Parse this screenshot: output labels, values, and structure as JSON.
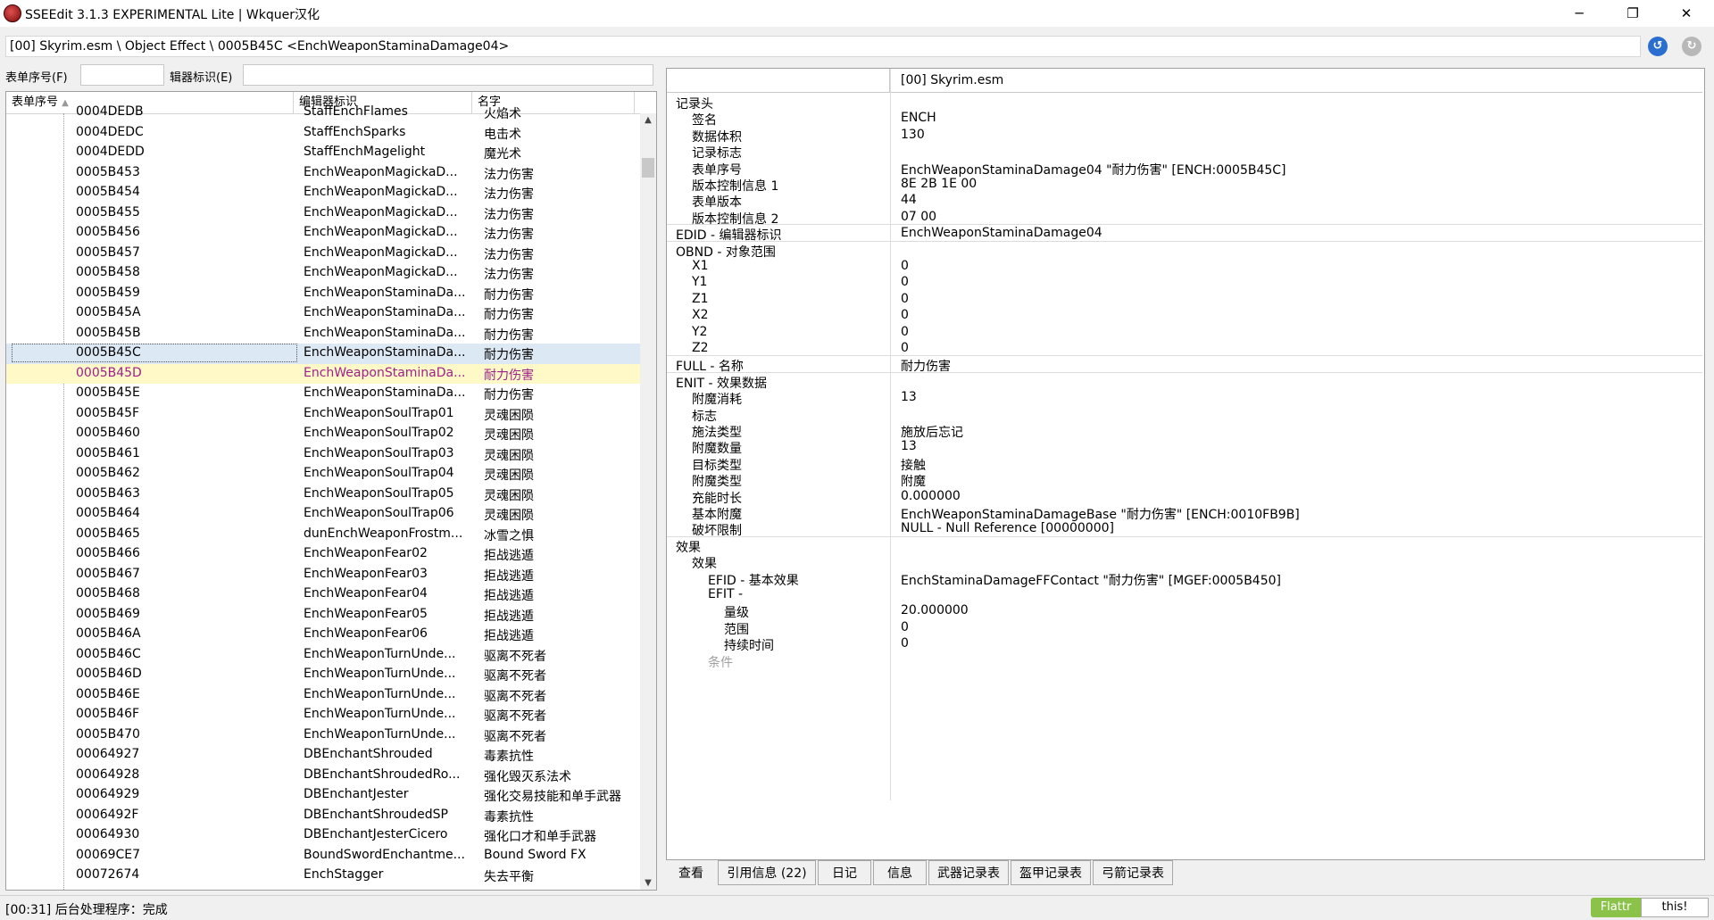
{
  "window": {
    "title": "SSEEdit 3.1.3 EXPERIMENTAL Lite  | Wkquer汉化",
    "minimize": "─",
    "maximize": "❐",
    "close": "✕"
  },
  "path": "[00] Skyrim.esm \\ Object Effect \\ 0005B45C <EnchWeaponStaminaDamage04>",
  "filter": {
    "formid_label": "表单序号(F)",
    "editorid_label": "辑器标识(E)",
    "formid_value": "",
    "editorid_value": ""
  },
  "list": {
    "columns": [
      "表单序号",
      "编辑器标识",
      "名字"
    ],
    "rows": [
      [
        "0004DEDB",
        "StaffEnchFlames",
        "火焰术"
      ],
      [
        "0004DEDC",
        "StaffEnchSparks",
        "电击术"
      ],
      [
        "0004DEDD",
        "StaffEnchMagelight",
        "魔光术"
      ],
      [
        "0005B453",
        "EnchWeaponMagickaD...",
        "法力伤害"
      ],
      [
        "0005B454",
        "EnchWeaponMagickaD...",
        "法力伤害"
      ],
      [
        "0005B455",
        "EnchWeaponMagickaD...",
        "法力伤害"
      ],
      [
        "0005B456",
        "EnchWeaponMagickaD...",
        "法力伤害"
      ],
      [
        "0005B457",
        "EnchWeaponMagickaD...",
        "法力伤害"
      ],
      [
        "0005B458",
        "EnchWeaponMagickaD...",
        "法力伤害"
      ],
      [
        "0005B459",
        "EnchWeaponStaminaDa...",
        "耐力伤害"
      ],
      [
        "0005B45A",
        "EnchWeaponStaminaDa...",
        "耐力伤害"
      ],
      [
        "0005B45B",
        "EnchWeaponStaminaDa...",
        "耐力伤害"
      ],
      [
        "0005B45C",
        "EnchWeaponStaminaDa...",
        "耐力伤害"
      ],
      [
        "0005B45D",
        "EnchWeaponStaminaDa...",
        "耐力伤害"
      ],
      [
        "0005B45E",
        "EnchWeaponStaminaDa...",
        "耐力伤害"
      ],
      [
        "0005B45F",
        "EnchWeaponSoulTrap01",
        "灵魂困陨"
      ],
      [
        "0005B460",
        "EnchWeaponSoulTrap02",
        "灵魂困陨"
      ],
      [
        "0005B461",
        "EnchWeaponSoulTrap03",
        "灵魂困陨"
      ],
      [
        "0005B462",
        "EnchWeaponSoulTrap04",
        "灵魂困陨"
      ],
      [
        "0005B463",
        "EnchWeaponSoulTrap05",
        "灵魂困陨"
      ],
      [
        "0005B464",
        "EnchWeaponSoulTrap06",
        "灵魂困陨"
      ],
      [
        "0005B465",
        "dunEnchWeaponFrostm...",
        "冰雪之惧"
      ],
      [
        "0005B466",
        "EnchWeaponFear02",
        "拒战逃遁"
      ],
      [
        "0005B467",
        "EnchWeaponFear03",
        "拒战逃遁"
      ],
      [
        "0005B468",
        "EnchWeaponFear04",
        "拒战逃遁"
      ],
      [
        "0005B469",
        "EnchWeaponFear05",
        "拒战逃遁"
      ],
      [
        "0005B46A",
        "EnchWeaponFear06",
        "拒战逃遁"
      ],
      [
        "0005B46C",
        "EnchWeaponTurnUnde...",
        "驱离不死者"
      ],
      [
        "0005B46D",
        "EnchWeaponTurnUnde...",
        "驱离不死者"
      ],
      [
        "0005B46E",
        "EnchWeaponTurnUnde...",
        "驱离不死者"
      ],
      [
        "0005B46F",
        "EnchWeaponTurnUnde...",
        "驱离不死者"
      ],
      [
        "0005B470",
        "EnchWeaponTurnUnde...",
        "驱离不死者"
      ],
      [
        "00064927",
        "DBEnchantShrouded",
        "毒素抗性"
      ],
      [
        "00064928",
        "DBEnchantShroudedRo...",
        "强化毁灭系法术"
      ],
      [
        "00064929",
        "DBEnchantJester",
        "强化交易技能和单手武器"
      ],
      [
        "0006492F",
        "DBEnchantShroudedSP",
        "毒素抗性"
      ],
      [
        "00064930",
        "DBEnchantJesterCicero",
        "强化口才和单手武器"
      ],
      [
        "00069CE7",
        "BoundSwordEnchantme...",
        "Bound Sword FX"
      ],
      [
        "00072674",
        "EnchStagger",
        "失去平衡"
      ]
    ],
    "selected_formid": "0005B45C",
    "highlighted_formid": "0005B45D"
  },
  "detail": {
    "header": "[00] Skyrim.esm",
    "rows": [
      {
        "k": "记录头",
        "v": "",
        "lvl": 0
      },
      {
        "k": "签名",
        "v": "ENCH",
        "lvl": 1
      },
      {
        "k": "数据体积",
        "v": "130",
        "lvl": 1
      },
      {
        "k": "记录标志",
        "v": "",
        "lvl": 1
      },
      {
        "k": "表单序号",
        "v": "EnchWeaponStaminaDamage04 \"耐力伤害\" [ENCH:0005B45C]",
        "lvl": 1
      },
      {
        "k": "版本控制信息 1",
        "v": "8E 2B 1E 00",
        "lvl": 1
      },
      {
        "k": "表单版本",
        "v": "44",
        "lvl": 1
      },
      {
        "k": "版本控制信息 2",
        "v": "07 00",
        "lvl": 1,
        "sep": true
      },
      {
        "k": "EDID - 编辑器标识",
        "v": "EnchWeaponStaminaDamage04",
        "lvl": 0,
        "sep": true
      },
      {
        "k": "OBND - 对象范围",
        "v": "",
        "lvl": 0
      },
      {
        "k": "X1",
        "v": "0",
        "lvl": 1
      },
      {
        "k": "Y1",
        "v": "0",
        "lvl": 1
      },
      {
        "k": "Z1",
        "v": "0",
        "lvl": 1
      },
      {
        "k": "X2",
        "v": "0",
        "lvl": 1
      },
      {
        "k": "Y2",
        "v": "0",
        "lvl": 1
      },
      {
        "k": "Z2",
        "v": "0",
        "lvl": 1,
        "sep": true
      },
      {
        "k": "FULL - 名称",
        "v": "耐力伤害",
        "lvl": 0,
        "sep": true
      },
      {
        "k": "ENIT - 效果数据",
        "v": "",
        "lvl": 0
      },
      {
        "k": "附魔消耗",
        "v": "13",
        "lvl": 1
      },
      {
        "k": "标志",
        "v": "",
        "lvl": 1
      },
      {
        "k": "施法类型",
        "v": "施放后忘记",
        "lvl": 1
      },
      {
        "k": "附魔数量",
        "v": "13",
        "lvl": 1
      },
      {
        "k": "目标类型",
        "v": "接触",
        "lvl": 1
      },
      {
        "k": "附魔类型",
        "v": "附魔",
        "lvl": 1
      },
      {
        "k": "充能时长",
        "v": "0.000000",
        "lvl": 1
      },
      {
        "k": "基本附魔",
        "v": "EnchWeaponStaminaDamageBase \"耐力伤害\" [ENCH:0010FB9B]",
        "lvl": 1
      },
      {
        "k": "破坏限制",
        "v": "NULL - Null Reference [00000000]",
        "lvl": 1,
        "sep": true
      },
      {
        "k": "效果",
        "v": "",
        "lvl": 0
      },
      {
        "k": "效果",
        "v": "",
        "lvl": 1
      },
      {
        "k": "EFID - 基本效果",
        "v": "EnchStaminaDamageFFContact \"耐力伤害\" [MGEF:0005B450]",
        "lvl": 2
      },
      {
        "k": "EFIT -",
        "v": "",
        "lvl": 2
      },
      {
        "k": "量级",
        "v": "20.000000",
        "lvl": 3
      },
      {
        "k": "范围",
        "v": "0",
        "lvl": 3
      },
      {
        "k": "持续时间",
        "v": "0",
        "lvl": 3
      },
      {
        "k": "条件",
        "v": "",
        "lvl": 2,
        "dim": true
      }
    ]
  },
  "tabs": [
    "查看",
    "引用信息 (22)",
    "日记",
    "信息",
    "武器记录表",
    "盔甲记录表",
    "弓箭记录表"
  ],
  "status": "[00:31] 后台处理程序：完成",
  "flattr": {
    "left": "Flattr",
    "right": "this!"
  }
}
